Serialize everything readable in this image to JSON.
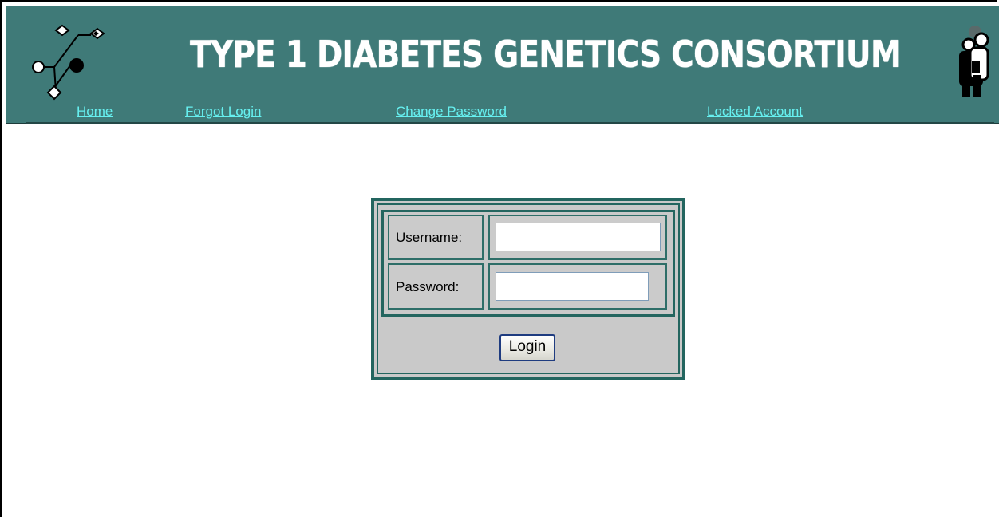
{
  "header": {
    "title": "TYPE 1 DIABETES GENETICS CONSORTIUM",
    "background_color": "#3f7a78",
    "left_logo_icon": "pedigree-logo-icon",
    "right_logo_icon": "family-group-icon"
  },
  "nav": {
    "link_color": "#66f0f0",
    "items": [
      {
        "label": "Home"
      },
      {
        "label": "Forgot Login"
      },
      {
        "label": "Change Password"
      },
      {
        "label": "Locked Account"
      }
    ]
  },
  "login_form": {
    "username_label": "Username:",
    "username_value": "",
    "password_label": "Password:",
    "password_value": "",
    "submit_label": "Login",
    "border_color": "#23655f",
    "panel_color": "#c9c9c9"
  }
}
